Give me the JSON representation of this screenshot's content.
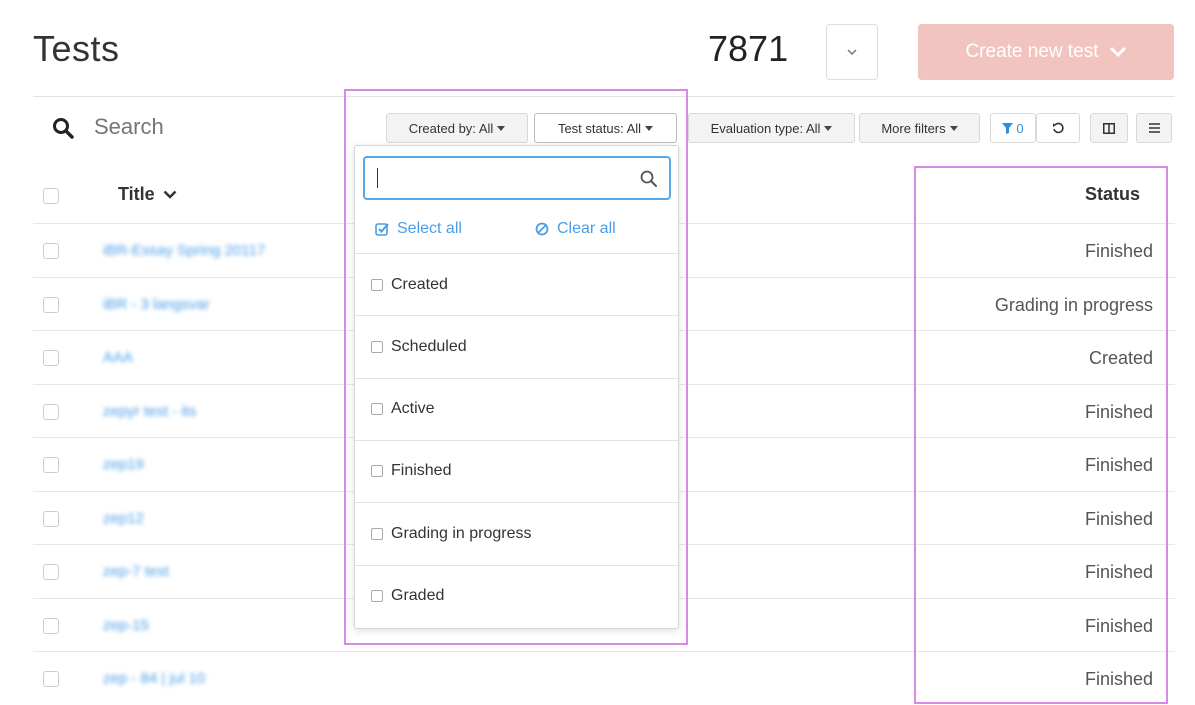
{
  "header": {
    "title": "Tests",
    "count": "7871",
    "create_button": "Create new test"
  },
  "search": {
    "placeholder": "Search"
  },
  "filters": {
    "created_by": "Created by: All",
    "test_status": "Test status: All",
    "evaluation_type": "Evaluation type: All",
    "more_filters": "More filters",
    "active_filter_count": "0"
  },
  "table": {
    "columns": {
      "title": "Title",
      "status": "Status"
    },
    "rows": [
      {
        "title": "iBR-Essay Spring 20117",
        "status": "Finished"
      },
      {
        "title": "iBR - 3 langsvar",
        "status": "Grading in progress"
      },
      {
        "title": "AAA",
        "status": "Created"
      },
      {
        "title": "zepyr test - its",
        "status": "Finished"
      },
      {
        "title": "zep19",
        "status": "Finished"
      },
      {
        "title": "zep12",
        "status": "Finished"
      },
      {
        "title": "zep-7 test",
        "status": "Finished"
      },
      {
        "title": "zep-15",
        "status": "Finished"
      },
      {
        "title": "zep - 84 | jul 10",
        "status": "Finished"
      }
    ]
  },
  "status_dropdown": {
    "select_all": "Select all",
    "clear_all": "Clear all",
    "options": [
      "Created",
      "Scheduled",
      "Active",
      "Finished",
      "Grading in progress",
      "Graded"
    ]
  },
  "colors": {
    "accent": "#4a9de6",
    "create_button": "#f1c4bf",
    "highlight": "#d58ae6"
  }
}
